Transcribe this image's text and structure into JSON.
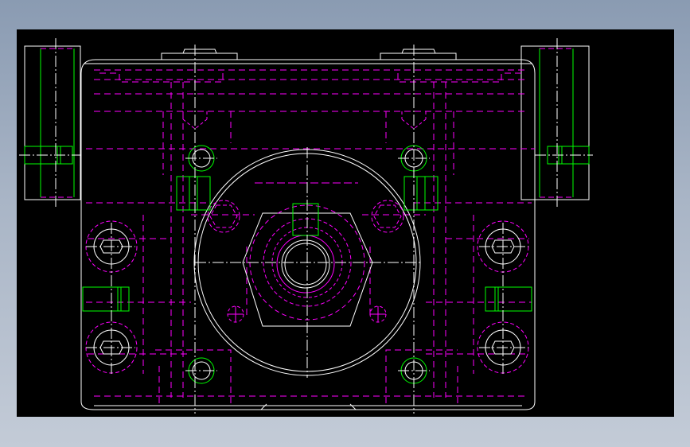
{
  "drawing": {
    "background_color": "#000000",
    "outline_color": "#ffffff",
    "hidden_line_color": "#ff00ff",
    "fastener_color": "#00ff00",
    "centerline_color": "#ffffff"
  }
}
